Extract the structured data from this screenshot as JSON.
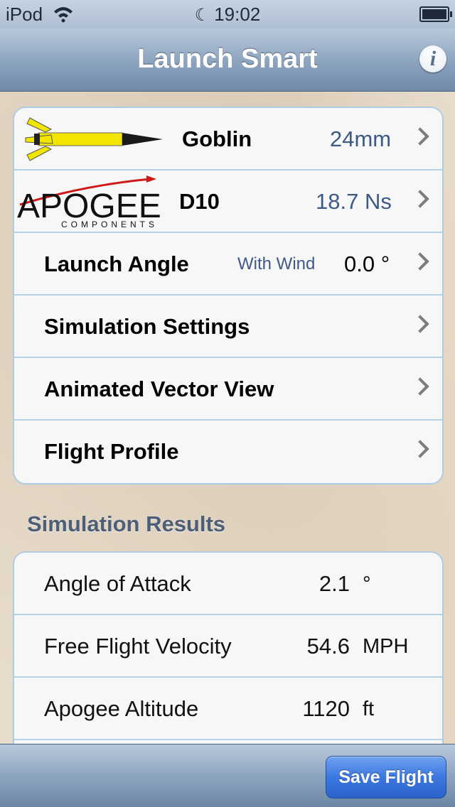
{
  "status_bar": {
    "carrier": "iPod",
    "time": "19:02",
    "moon_glyph": "☾"
  },
  "nav": {
    "title": "Launch Smart",
    "info_glyph": "i"
  },
  "config": {
    "rocket": {
      "name": "Goblin",
      "value": "24mm"
    },
    "motor": {
      "brand": "APOGEE",
      "brand_sub": "COMPONENTS",
      "name": "D10",
      "value": "18.7 Ns"
    },
    "launch_angle": {
      "label": "Launch Angle",
      "sub": "With Wind",
      "value": "0.0 °"
    },
    "simulation_settings": {
      "label": "Simulation Settings"
    },
    "animated_vector_view": {
      "label": "Animated Vector View"
    },
    "flight_profile": {
      "label": "Flight Profile"
    }
  },
  "results": {
    "header": "Simulation Results",
    "rows": [
      {
        "label": "Angle of Attack",
        "value": "2.1",
        "unit": "°"
      },
      {
        "label": "Free Flight Velocity",
        "value": "54.6",
        "unit": "MPH"
      },
      {
        "label": "Apogee Altitude",
        "value": "1120",
        "unit": "ft"
      }
    ]
  },
  "toolbar": {
    "save_label": "Save Flight"
  },
  "colors": {
    "accent_blue": "#3d5a87",
    "row_border": "#b9d3e6",
    "rocket_yellow": "#f2e600"
  },
  "icons": [
    "wifi-icon",
    "moon-icon",
    "battery-icon",
    "info-icon",
    "rocket-image",
    "apogee-logo",
    "chevron-right-icon"
  ]
}
